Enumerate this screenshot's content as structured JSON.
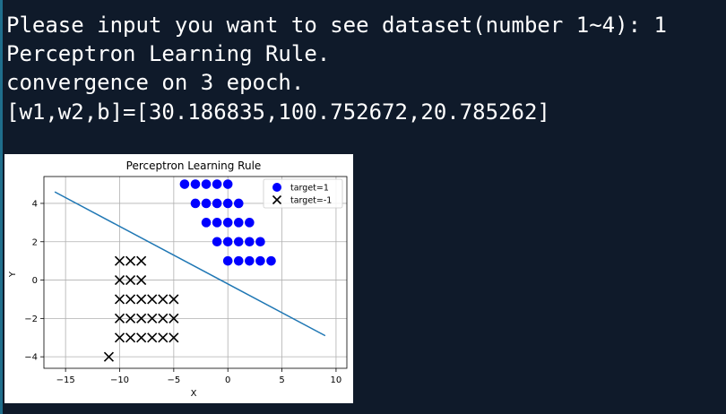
{
  "terminal": {
    "lines": [
      "Please input you want to see dataset(number 1~4): 1",
      "Perceptron Learning Rule.",
      "convergence on 3 epoch.",
      "[w1,w2,b]=[30.186835,100.752672,20.785262]"
    ]
  },
  "chart_data": {
    "type": "scatter",
    "title": "Perceptron Learning Rule",
    "xlabel": "X",
    "ylabel": "Y",
    "xlim": [
      -17,
      11
    ],
    "ylim": [
      -4.6,
      5.4
    ],
    "xticks": [
      -15,
      -10,
      -5,
      0,
      5,
      10
    ],
    "yticks": [
      -4,
      -2,
      0,
      2,
      4
    ],
    "xtick_labels": [
      "−15",
      "−10",
      "−5",
      "0",
      "5",
      "10"
    ],
    "ytick_labels": [
      "−4",
      "−2",
      "0",
      "2",
      "4"
    ],
    "grid": true,
    "legend": "top-right",
    "series": [
      {
        "name": "target=1",
        "marker": "circle",
        "color": "#0000ff",
        "points": [
          [
            -4,
            5
          ],
          [
            -3,
            5
          ],
          [
            -2,
            5
          ],
          [
            -1,
            5
          ],
          [
            0,
            5
          ],
          [
            -3,
            4
          ],
          [
            -2,
            4
          ],
          [
            -1,
            4
          ],
          [
            0,
            4
          ],
          [
            1,
            4
          ],
          [
            -2,
            3
          ],
          [
            -1,
            3
          ],
          [
            0,
            3
          ],
          [
            1,
            3
          ],
          [
            2,
            3
          ],
          [
            -1,
            2
          ],
          [
            0,
            2
          ],
          [
            1,
            2
          ],
          [
            2,
            2
          ],
          [
            3,
            2
          ],
          [
            0,
            1
          ],
          [
            1,
            1
          ],
          [
            2,
            1
          ],
          [
            3,
            1
          ],
          [
            4,
            1
          ]
        ]
      },
      {
        "name": "target=-1",
        "marker": "x",
        "color": "#000000",
        "points": [
          [
            -10,
            1
          ],
          [
            -9,
            1
          ],
          [
            -8,
            1
          ],
          [
            -10,
            0
          ],
          [
            -9,
            0
          ],
          [
            -8,
            0
          ],
          [
            -10,
            -1
          ],
          [
            -9,
            -1
          ],
          [
            -8,
            -1
          ],
          [
            -7,
            -1
          ],
          [
            -6,
            -1
          ],
          [
            -5,
            -1
          ],
          [
            -10,
            -2
          ],
          [
            -9,
            -2
          ],
          [
            -8,
            -2
          ],
          [
            -7,
            -2
          ],
          [
            -6,
            -2
          ],
          [
            -5,
            -2
          ],
          [
            -10,
            -3
          ],
          [
            -9,
            -3
          ],
          [
            -8,
            -3
          ],
          [
            -7,
            -3
          ],
          [
            -6,
            -3
          ],
          [
            -5,
            -3
          ],
          [
            -11,
            -4
          ]
        ]
      }
    ],
    "decision_line": {
      "color": "#1f77b4",
      "points": [
        [
          -16,
          4.6
        ],
        [
          9,
          -2.9
        ]
      ]
    }
  }
}
